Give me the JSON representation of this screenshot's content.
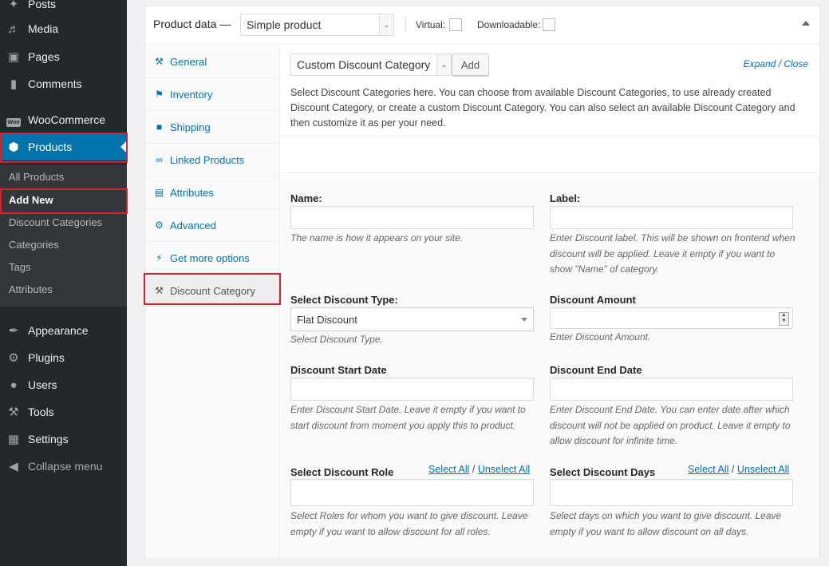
{
  "sidebar": {
    "items": [
      {
        "label": "Posts",
        "icon": "pin-icon"
      },
      {
        "label": "Media",
        "icon": "media-icon"
      },
      {
        "label": "Pages",
        "icon": "pages-icon"
      },
      {
        "label": "Comments",
        "icon": "comments-icon"
      },
      {
        "label": "WooCommerce",
        "icon": "woocommerce-icon"
      },
      {
        "label": "Products",
        "icon": "products-icon"
      },
      {
        "label": "Appearance",
        "icon": "appearance-icon"
      },
      {
        "label": "Plugins",
        "icon": "plugins-icon"
      },
      {
        "label": "Users",
        "icon": "users-icon"
      },
      {
        "label": "Tools",
        "icon": "tools-icon"
      },
      {
        "label": "Settings",
        "icon": "settings-icon"
      },
      {
        "label": "Collapse menu",
        "icon": "collapse-icon"
      }
    ],
    "woo_icon_text": "Woo",
    "submenu": [
      "All Products",
      "Add New",
      "Discount Categories",
      "Categories",
      "Tags",
      "Attributes"
    ]
  },
  "product_data": {
    "title": "Product data —",
    "type_select": "Simple product",
    "virtual_label": "Virtual:",
    "downloadable_label": "Downloadable:",
    "tabs": [
      "General",
      "Inventory",
      "Shipping",
      "Linked Products",
      "Attributes",
      "Advanced",
      "Get more options",
      "Discount Category"
    ]
  },
  "discount": {
    "category_select": "Custom Discount Category",
    "add_button": "Add",
    "expand": "Expand",
    "close": "Close",
    "link_sep": " / ",
    "description": "Select Discount Categories here. You can choose from available Discount Categories, to use already created Discount Category, or create a custom Discount Category. You can also select an available Discount Category and then customize it as per your need.",
    "name_label": "Name:",
    "name_help": "The name is how it appears on your site.",
    "label_label": "Label:",
    "label_help": "Enter Discount label. This will be shown on frontend when discount will be applied. Leave it empty if you want to show \"Name\" of category.",
    "type_label": "Select Discount Type:",
    "type_value": "Flat Discount",
    "type_help": "Select Discount Type.",
    "amount_label": "Discount Amount",
    "amount_help": "Enter Discount Amount.",
    "start_label": "Discount Start Date",
    "start_help": "Enter Discount Start Date. Leave it empty if you want to start discount from moment you apply this to product.",
    "end_label": "Discount End Date",
    "end_help": "Enter Discount End Date. You can enter date after which discount will not be applied on product. Leave it empty to allow discount for infinite time.",
    "role_label": "Select Discount Role",
    "role_help": "Select Roles for whom you want to give discount. Leave empty if you want to allow discount for all roles.",
    "days_label": "Select Discount Days",
    "days_help": "Select days on which you want to give discount. Leave empty if you want to allow discount on all days.",
    "select_all": "Select All",
    "unselect_all": "Unselect All",
    "slash": "/"
  }
}
